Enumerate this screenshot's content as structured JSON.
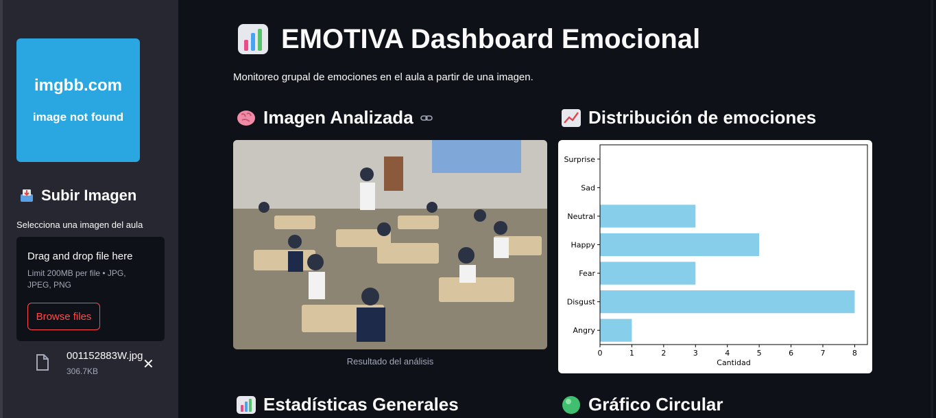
{
  "sidebar": {
    "logo_line1": "imgbb.com",
    "logo_line2": "image not found",
    "upload_title": "Subir Imagen",
    "upload_label": "Selecciona una imagen del aula",
    "dropzone_title": "Drag and drop file here",
    "dropzone_limit": "Limit 200MB per file • JPG, JPEG, PNG",
    "browse_label": "Browse files",
    "file_name": "001152883W.jpg",
    "file_size": "306.7KB"
  },
  "main": {
    "title": "EMOTIVA Dashboard Emocional",
    "subtitle": "Monitoreo grupal de emociones en el aula a partir de una imagen.",
    "image_section_title": "Imagen Analizada",
    "image_caption": "Resultado del análisis",
    "chart_section_title": "Distribución de emociones",
    "stats_section_title": "Estadísticas Generales",
    "pie_section_title": "Gráfico Circular"
  },
  "colors": {
    "accent": "#ff4b4b",
    "bar": "#87ceeb",
    "logo_bg": "#2aa7e0"
  },
  "chart_data": {
    "type": "bar",
    "orientation": "horizontal",
    "categories": [
      "Angry",
      "Disgust",
      "Fear",
      "Happy",
      "Neutral",
      "Sad",
      "Surprise"
    ],
    "values": [
      1,
      8,
      3,
      5,
      3,
      0,
      0
    ],
    "xlabel": "Cantidad",
    "ylabel": "",
    "xlim": [
      0,
      8.4
    ],
    "xticks": [
      0,
      1,
      2,
      3,
      4,
      5,
      6,
      7,
      8
    ]
  }
}
